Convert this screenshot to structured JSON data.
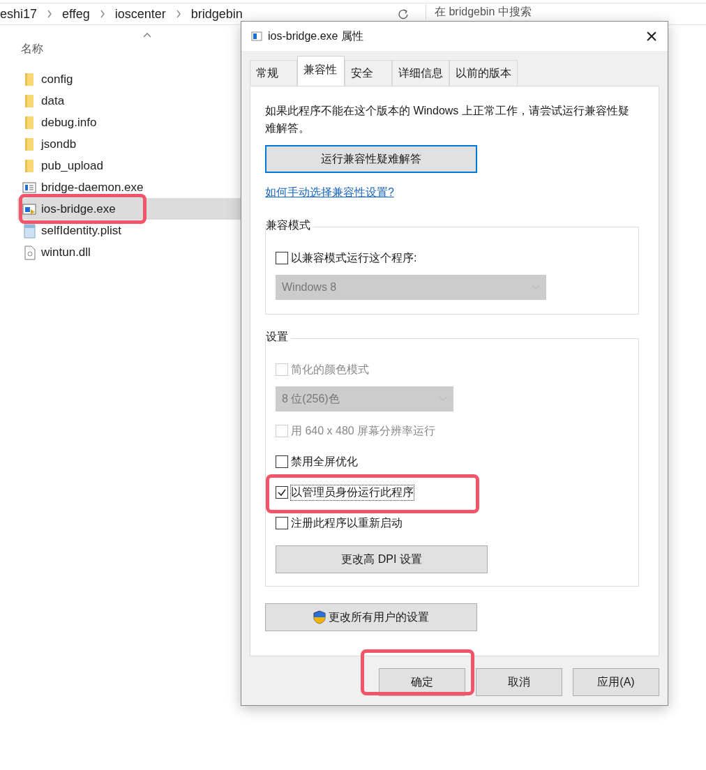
{
  "explorer": {
    "breadcrumb": [
      "eshi17",
      "effeg",
      "ioscenter",
      "bridgebin"
    ],
    "search": {
      "placeholder": "在 bridgebin 中搜索"
    },
    "column_header": "名称",
    "files": [
      {
        "name": "config",
        "kind": "folder",
        "selected": false,
        "highlighted": false
      },
      {
        "name": "data",
        "kind": "folder",
        "selected": false,
        "highlighted": false
      },
      {
        "name": "debug.info",
        "kind": "folder",
        "selected": false,
        "highlighted": false
      },
      {
        "name": "jsondb",
        "kind": "folder",
        "selected": false,
        "highlighted": false
      },
      {
        "name": "pub_upload",
        "kind": "folder",
        "selected": false,
        "highlighted": false
      },
      {
        "name": "bridge-daemon.exe",
        "kind": "exe",
        "selected": false,
        "highlighted": false
      },
      {
        "name": "ios-bridge.exe",
        "kind": "app",
        "selected": true,
        "highlighted": true
      },
      {
        "name": "selfIdentity.plist",
        "kind": "plist",
        "selected": false,
        "highlighted": false
      },
      {
        "name": "wintun.dll",
        "kind": "dll",
        "selected": false,
        "highlighted": false
      }
    ]
  },
  "dialog": {
    "title": "ios-bridge.exe 属性",
    "close": "×",
    "tabs": [
      {
        "label": "常规",
        "selected": false
      },
      {
        "label": "兼容性",
        "selected": true
      },
      {
        "label": "安全",
        "selected": false
      },
      {
        "label": "详细信息",
        "selected": false
      },
      {
        "label": "以前的版本",
        "selected": false
      }
    ],
    "description": "如果此程序不能在这个版本的 Windows 上正常工作，请尝试运行兼容性疑难解答。",
    "troubleshoot_button": "运行兼容性疑难解答",
    "help_link": "如何手动选择兼容性设置?",
    "groups": [
      {
        "title": "兼容模式",
        "items": [
          {
            "kind": "checkbox",
            "label": "以兼容模式运行这个程序:",
            "checked": false,
            "disabled": false,
            "highlighted": false
          },
          {
            "kind": "select",
            "value": "Windows 8",
            "disabled": true
          }
        ]
      },
      {
        "title": "设置",
        "items": [
          {
            "kind": "checkbox",
            "label": "简化的颜色模式",
            "checked": false,
            "disabled": true,
            "highlighted": false
          },
          {
            "kind": "select",
            "value": "8 位(256)色",
            "disabled": true
          },
          {
            "kind": "checkbox",
            "label": "用 640 x 480 屏幕分辨率运行",
            "checked": false,
            "disabled": true,
            "highlighted": false
          },
          {
            "kind": "checkbox",
            "label": "禁用全屏优化",
            "checked": false,
            "disabled": false,
            "highlighted": false
          },
          {
            "kind": "checkbox",
            "label": "以管理员身份运行此程序",
            "checked": true,
            "disabled": false,
            "highlighted": true
          },
          {
            "kind": "checkbox",
            "label": "注册此程序以重新启动",
            "checked": false,
            "disabled": false,
            "highlighted": false
          },
          {
            "kind": "button",
            "label": "更改高 DPI 设置"
          }
        ]
      }
    ],
    "all_users_button": "更改所有用户的设置",
    "buttons": [
      {
        "label": "确定",
        "highlighted": true
      },
      {
        "label": "取消",
        "highlighted": false
      },
      {
        "label": "应用(A)",
        "highlighted": false
      }
    ]
  }
}
